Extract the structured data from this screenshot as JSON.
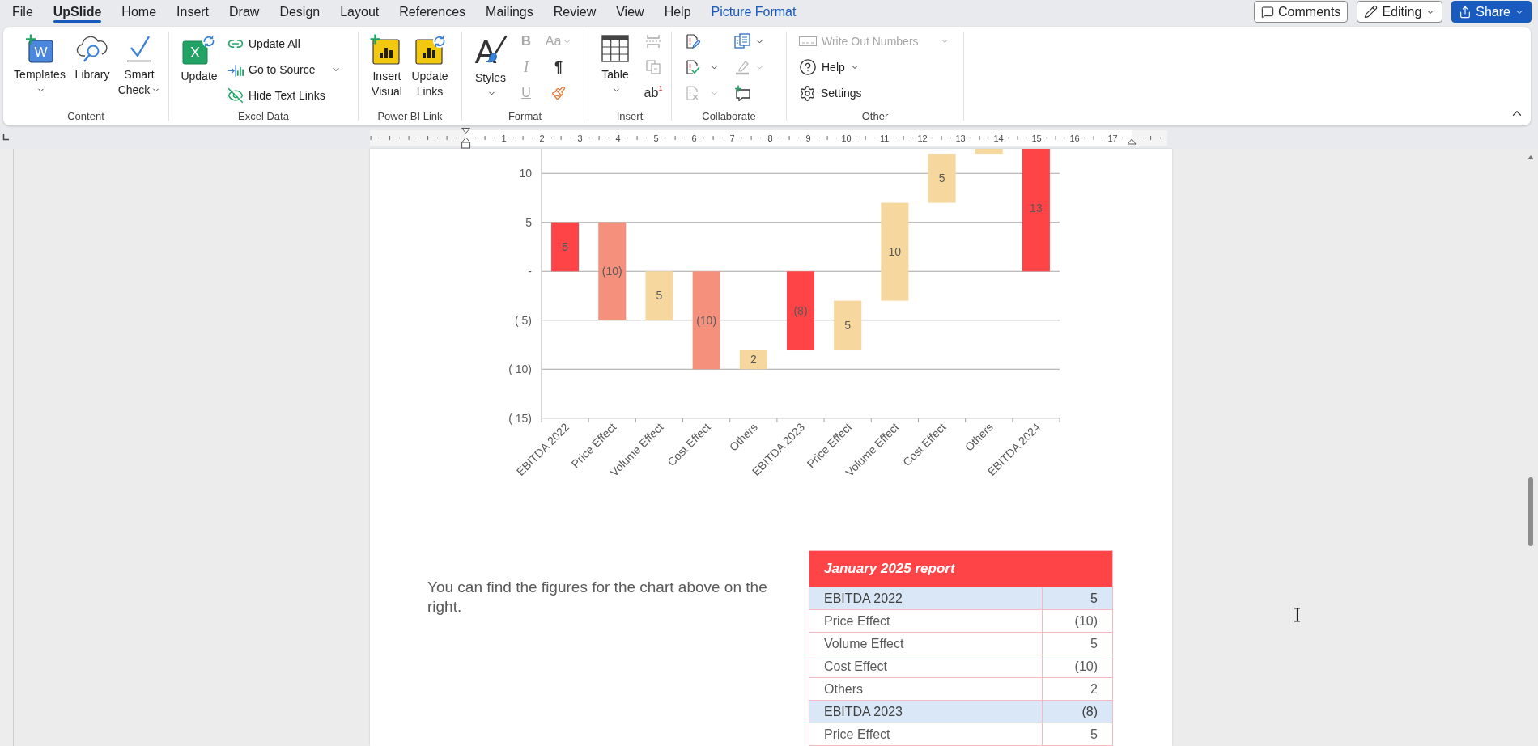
{
  "menu_tabs": [
    {
      "label": "File",
      "selected": false,
      "contextual": false
    },
    {
      "label": "UpSlide",
      "selected": true,
      "contextual": false
    },
    {
      "label": "Home",
      "selected": false,
      "contextual": false
    },
    {
      "label": "Insert",
      "selected": false,
      "contextual": false
    },
    {
      "label": "Draw",
      "selected": false,
      "contextual": false
    },
    {
      "label": "Design",
      "selected": false,
      "contextual": false
    },
    {
      "label": "Layout",
      "selected": false,
      "contextual": false
    },
    {
      "label": "References",
      "selected": false,
      "contextual": false
    },
    {
      "label": "Mailings",
      "selected": false,
      "contextual": false
    },
    {
      "label": "Review",
      "selected": false,
      "contextual": false
    },
    {
      "label": "View",
      "selected": false,
      "contextual": false
    },
    {
      "label": "Help",
      "selected": false,
      "contextual": false
    },
    {
      "label": "Picture Format",
      "selected": false,
      "contextual": true
    }
  ],
  "header_buttons": [
    {
      "kind": "comments",
      "label": "Comments"
    },
    {
      "kind": "editing",
      "label": "Editing"
    },
    {
      "kind": "share",
      "label": "Share"
    }
  ],
  "ribbon": {
    "content": {
      "label": "Content",
      "buttons": [
        {
          "label": "Templates",
          "dropdown": true,
          "icon_glyph": "W"
        },
        {
          "label": "Library",
          "dropdown": false
        },
        {
          "label": "Smart Check",
          "dropdown": true
        }
      ]
    },
    "excel_data": {
      "label": "Excel Data",
      "update": {
        "label": "Update",
        "icon_glyph": "X"
      },
      "small_buttons": [
        {
          "label": "Update All",
          "dropdown": false
        },
        {
          "label": "Go to Source",
          "dropdown": true
        },
        {
          "label": "Hide Text Links",
          "dropdown": false
        }
      ]
    },
    "power_bi_link": {
      "label": "Power BI Link",
      "buttons": [
        {
          "label": "Insert Visual"
        },
        {
          "label": "Update Links"
        }
      ]
    },
    "format": {
      "label": "Format",
      "styles": {
        "label": "Styles",
        "dropdown": true,
        "icon_glyph": "A"
      },
      "tools": [
        {
          "kind": "bold",
          "glyph": "B",
          "disabled": true,
          "dropdown": false
        },
        {
          "kind": "case",
          "glyph": "Aa",
          "disabled": true,
          "dropdown": true
        },
        {
          "kind": "italic",
          "glyph": "I",
          "disabled": true,
          "dropdown": false
        },
        {
          "kind": "pilcrow",
          "glyph": "¶",
          "disabled": false,
          "dropdown": false
        },
        {
          "kind": "underline",
          "glyph": "U",
          "disabled": true,
          "dropdown": false
        },
        {
          "kind": "painter",
          "disabled": false,
          "dropdown": false
        }
      ]
    },
    "insert": {
      "label": "Insert",
      "table": {
        "label": "Table",
        "dropdown": true
      },
      "tools": [
        {
          "kind": "header_rows",
          "disabled": true
        },
        {
          "kind": "split",
          "disabled": true
        },
        {
          "kind": "footnote",
          "disabled": false,
          "glyph": "ab",
          "superscript": "1"
        }
      ]
    },
    "collaborate": {
      "label": "Collaborate",
      "tools": [
        {
          "kind": "edit_doc",
          "disabled": false,
          "dropdown": false
        },
        {
          "kind": "pages",
          "disabled": false,
          "dropdown": true
        },
        {
          "kind": "check_doc",
          "disabled": false,
          "dropdown": true
        },
        {
          "kind": "highlighter",
          "disabled": true,
          "dropdown": true
        },
        {
          "kind": "remove_doc",
          "disabled": true,
          "dropdown": true
        },
        {
          "kind": "new_comment",
          "disabled": false,
          "dropdown": false
        }
      ]
    },
    "other": {
      "label": "Other",
      "items": [
        {
          "label": "Write Out Numbers",
          "disabled": true,
          "dropdown": true
        },
        {
          "label": "Help",
          "disabled": false,
          "dropdown": true
        },
        {
          "label": "Settings",
          "disabled": false,
          "dropdown": false
        }
      ]
    }
  },
  "ruler": {
    "numbers": [
      "1",
      "2",
      "3",
      "4",
      "5",
      "6",
      "7",
      "8",
      "9",
      "10",
      "11",
      "12",
      "13",
      "14",
      "15",
      "16",
      "17"
    ]
  },
  "waterfall_chart": {
    "y_tick_labels": [
      "10",
      "5",
      "-",
      "( 5)",
      "( 10)",
      "( 15)"
    ],
    "bars": [
      {
        "category": "EBITDA 2022",
        "value_label": "5",
        "color": "#ff4447"
      },
      {
        "category": "Price Effect",
        "value_label": "(10)",
        "color": "#f4907c"
      },
      {
        "category": "Volume Effect",
        "value_label": "5",
        "color": "#f6d89e"
      },
      {
        "category": "Cost Effect",
        "value_label": "(10)",
        "color": "#f4907c"
      },
      {
        "category": "Others",
        "value_label": "2",
        "color": "#f6d89e"
      },
      {
        "category": "EBITDA 2023",
        "value_label": "(8)",
        "color": "#ff4447"
      },
      {
        "category": "Price Effect",
        "value_label": "5",
        "color": "#f6d89e"
      },
      {
        "category": "Volume Effect",
        "value_label": "10",
        "color": "#f6d89e"
      },
      {
        "category": "Cost Effect",
        "value_label": "5",
        "color": "#f6d89e"
      },
      {
        "category": "Others",
        "color": "#f6d89e"
      },
      {
        "category": "EBITDA 2024",
        "value_label": "13",
        "color": "#ff4447"
      }
    ]
  },
  "paragraph": "You can find the figures for the chart above on the right.",
  "report_table": {
    "title": "January 2025 report",
    "rows": [
      {
        "kind": "total",
        "label": "EBITDA 2022",
        "value": "5"
      },
      {
        "kind": "item",
        "label": "Price Effect",
        "value": "(10)"
      },
      {
        "kind": "item",
        "label": "Volume Effect",
        "value": "5"
      },
      {
        "kind": "item",
        "label": "Cost Effect",
        "value": "(10)"
      },
      {
        "kind": "item",
        "label": "Others",
        "value": "2"
      },
      {
        "kind": "total",
        "label": "EBITDA 2023",
        "value": "(8)"
      },
      {
        "kind": "item",
        "label": "Price Effect",
        "value": "5"
      }
    ]
  }
}
